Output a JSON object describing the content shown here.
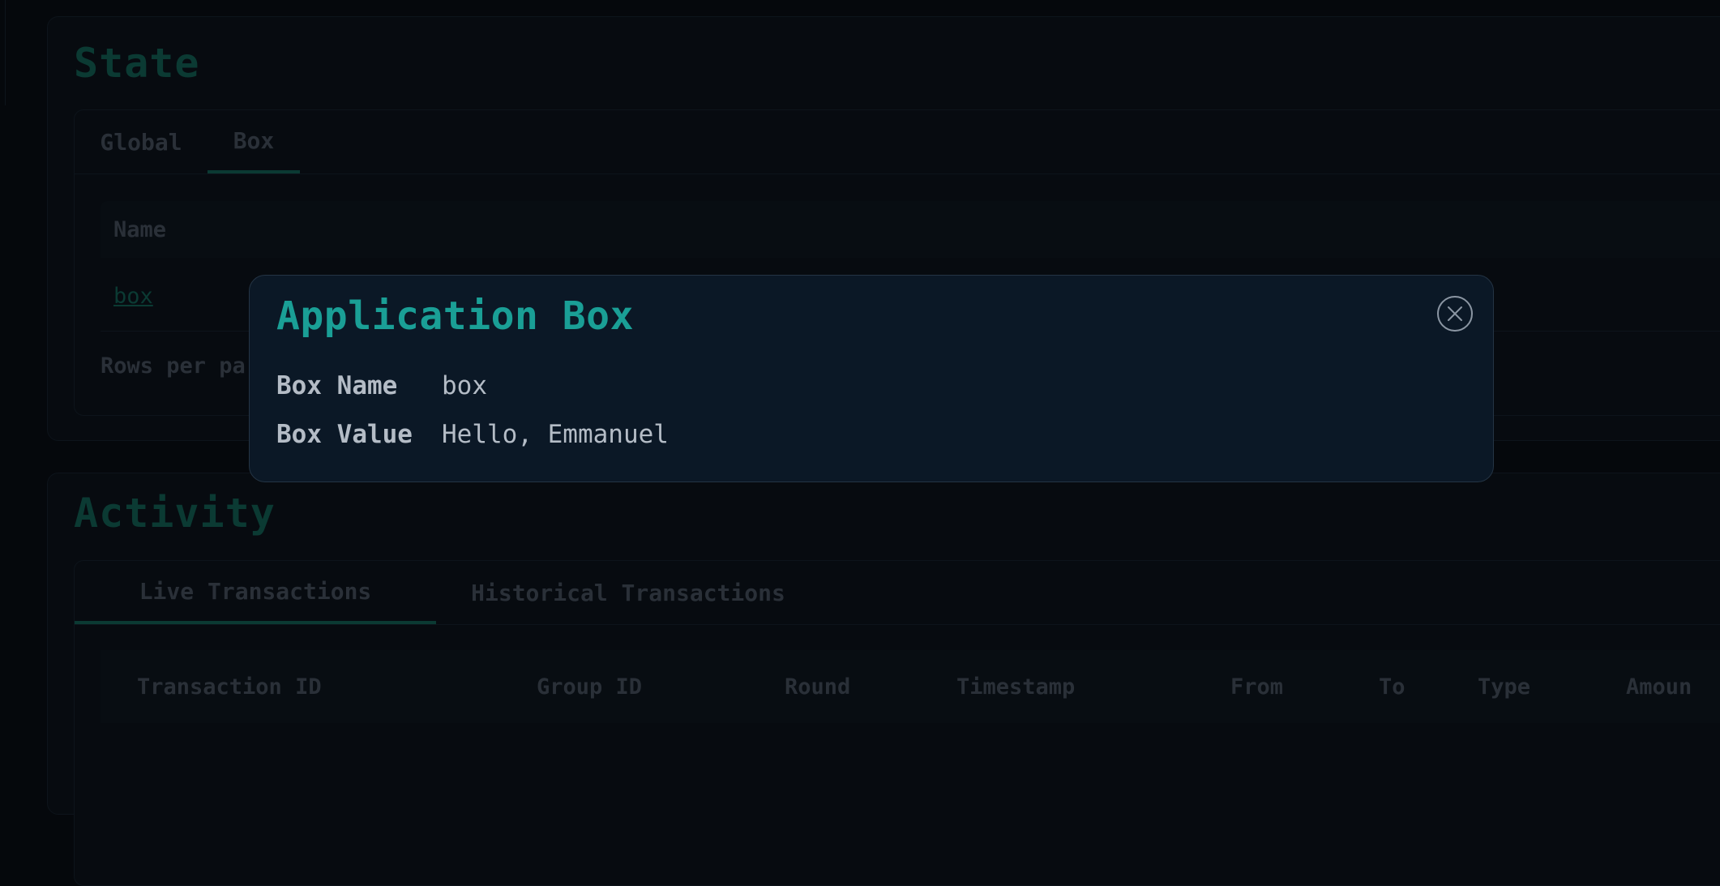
{
  "state": {
    "title": "State",
    "tabs": [
      {
        "label": "Global"
      },
      {
        "label": "Box"
      }
    ],
    "table": {
      "header": "Name",
      "rows": [
        {
          "name": "box"
        }
      ]
    },
    "rows_per_page_label": "Rows per pa"
  },
  "activity": {
    "title": "Activity",
    "tabs": [
      {
        "label": "Live Transactions"
      },
      {
        "label": "Historical Transactions"
      }
    ],
    "columns": [
      "Transaction ID",
      "Group ID",
      "Round",
      "Timestamp",
      "From",
      "To",
      "Type",
      "Amoun"
    ]
  },
  "modal": {
    "title": "Application Box",
    "close_icon": "close-icon",
    "fields": [
      {
        "label": "Box Name",
        "value": "box"
      },
      {
        "label": "Box Value",
        "value": "Hello, Emmanuel"
      }
    ]
  },
  "colors": {
    "accent": "#1a9f96",
    "modal_bg": "#0b1826",
    "page_bg": "#05080c"
  }
}
